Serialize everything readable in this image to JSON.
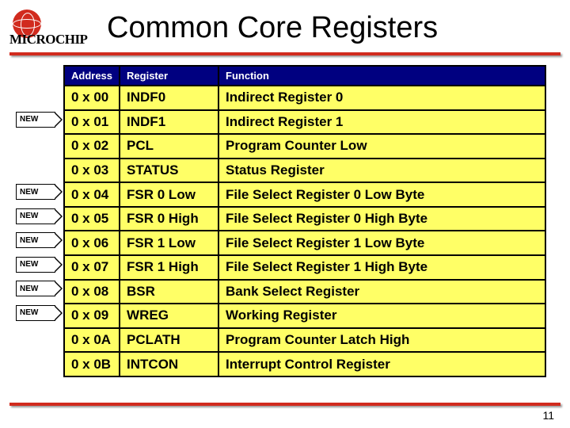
{
  "logo_text": "MICROCHIP",
  "title": "Common Core Registers",
  "new_label": "NEW",
  "columns": {
    "address": "Address",
    "register": "Register",
    "function": "Function"
  },
  "rows": [
    {
      "addr": "0 x 00",
      "reg": "INDF0",
      "func": "Indirect Register 0",
      "new": false
    },
    {
      "addr": "0 x 01",
      "reg": "INDF1",
      "func": "Indirect Register 1",
      "new": true
    },
    {
      "addr": "0 x 02",
      "reg": "PCL",
      "func": "Program Counter Low",
      "new": false
    },
    {
      "addr": "0 x 03",
      "reg": "STATUS",
      "func": "Status Register",
      "new": false
    },
    {
      "addr": "0 x 04",
      "reg": "FSR 0 Low",
      "func": "File Select Register 0 Low Byte",
      "new": true
    },
    {
      "addr": "0 x 05",
      "reg": "FSR 0 High",
      "func": "File Select Register 0 High Byte",
      "new": true
    },
    {
      "addr": "0 x 06",
      "reg": "FSR 1 Low",
      "func": "File Select Register 1 Low Byte",
      "new": true
    },
    {
      "addr": "0 x 07",
      "reg": "FSR 1 High",
      "func": "File Select Register 1 High Byte",
      "new": true
    },
    {
      "addr": "0 x 08",
      "reg": "BSR",
      "func": "Bank Select Register",
      "new": true
    },
    {
      "addr": "0 x 09",
      "reg": "WREG",
      "func": "Working Register",
      "new": true
    },
    {
      "addr": "0 x 0A",
      "reg": "PCLATH",
      "func": "Program Counter Latch High",
      "new": false
    },
    {
      "addr": "0 x 0B",
      "reg": "INTCON",
      "func": "Interrupt Control Register",
      "new": false
    }
  ],
  "page_number": "11"
}
